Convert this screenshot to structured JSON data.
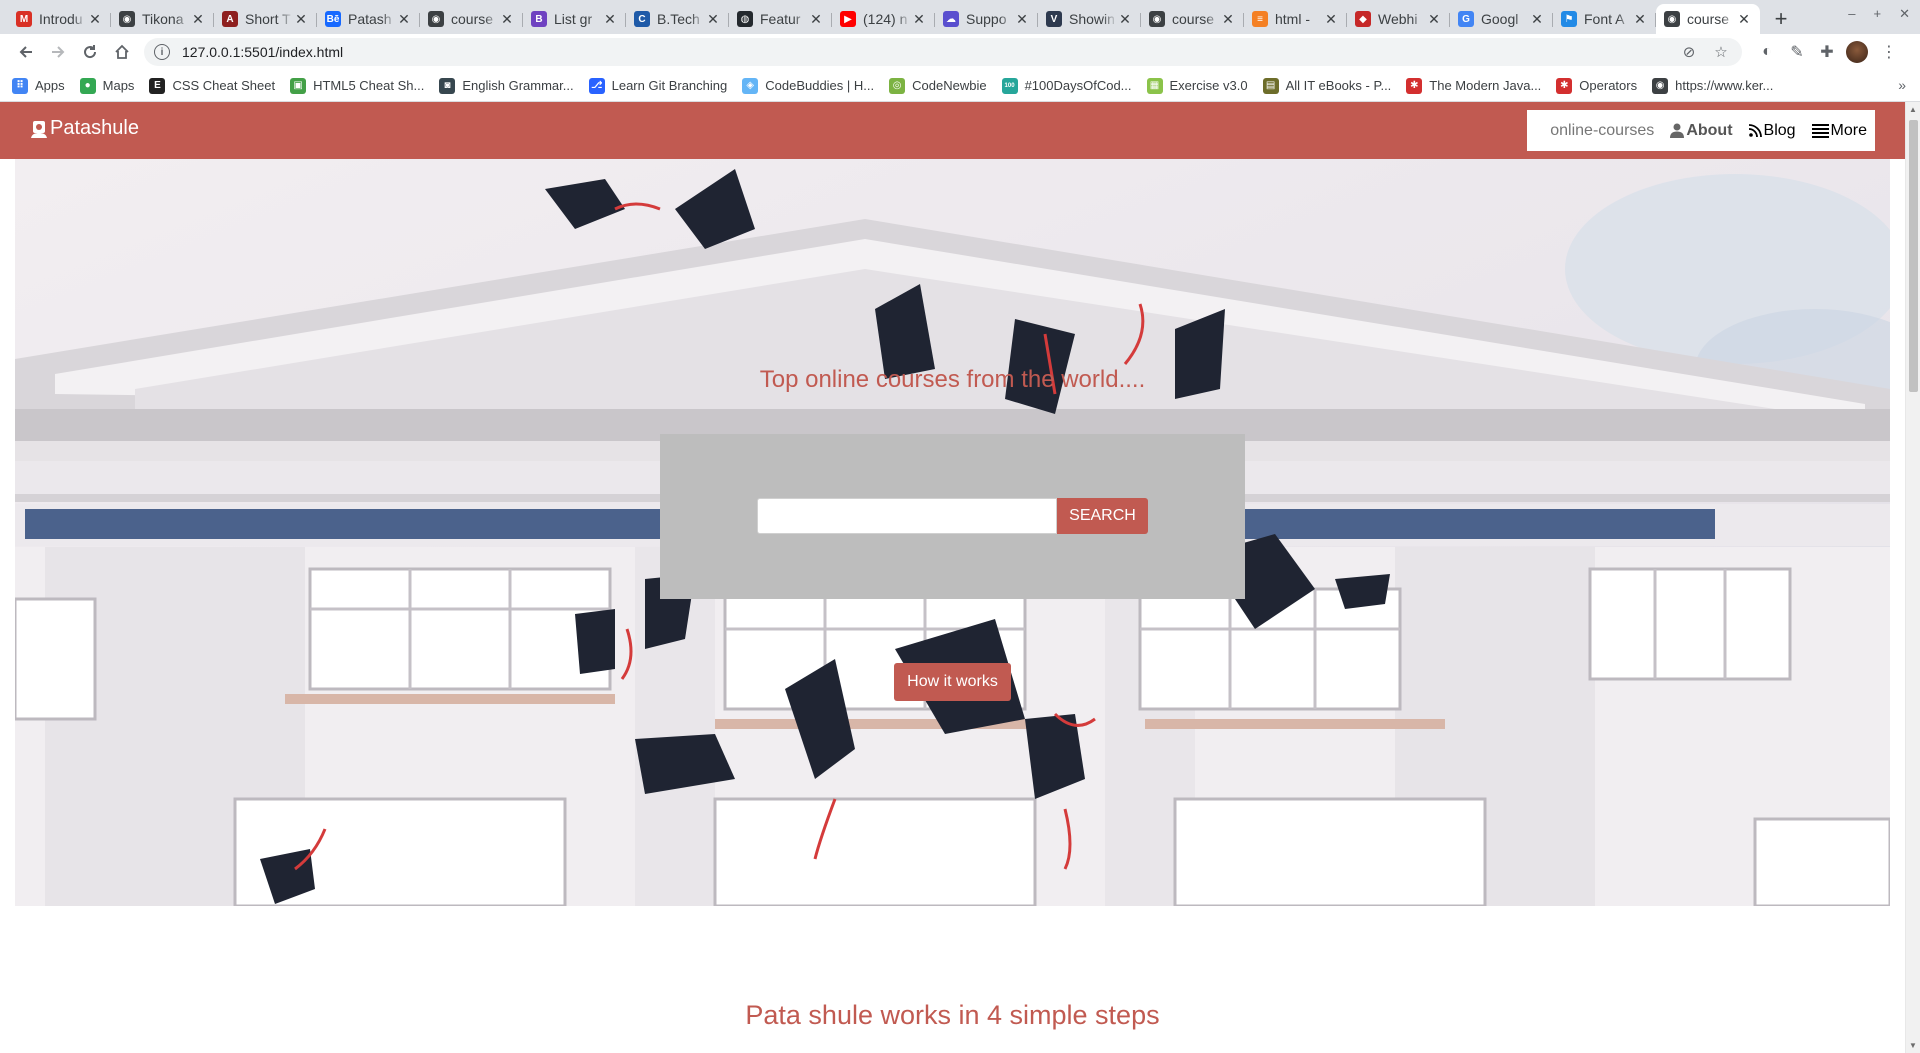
{
  "browser": {
    "tabs": [
      {
        "title": "Introdu",
        "icon": "gmail-icon",
        "color": "#d93025",
        "glyph": "M"
      },
      {
        "title": "Tikona",
        "icon": "globe-icon",
        "color": "#3c4043",
        "glyph": "◉"
      },
      {
        "title": "Short T",
        "icon": "site-icon",
        "color": "#8e1f1f",
        "glyph": "A"
      },
      {
        "title": "Patash",
        "icon": "behance-icon",
        "color": "#1769ff",
        "glyph": "Bē"
      },
      {
        "title": "course",
        "icon": "globe-icon",
        "color": "#3c4043",
        "glyph": "◉"
      },
      {
        "title": "List gr",
        "icon": "bootstrap-icon",
        "color": "#6f42c1",
        "glyph": "B"
      },
      {
        "title": "B.Tech",
        "icon": "site-c-icon",
        "color": "#1e5aa8",
        "glyph": "C"
      },
      {
        "title": "Featur",
        "icon": "github-icon",
        "color": "#24292e",
        "glyph": "◍"
      },
      {
        "title": "(124) n",
        "icon": "youtube-icon",
        "color": "#ff0000",
        "glyph": "▶"
      },
      {
        "title": "Suppo",
        "icon": "cloud-icon",
        "color": "#5a4fcf",
        "glyph": "☁"
      },
      {
        "title": "Showin",
        "icon": "vue-icon",
        "color": "#2e3a4f",
        "glyph": "V"
      },
      {
        "title": "course",
        "icon": "globe-icon",
        "color": "#3c4043",
        "glyph": "◉"
      },
      {
        "title": "html - ",
        "icon": "stackoverflow-icon",
        "color": "#f48024",
        "glyph": "≡"
      },
      {
        "title": "Webhi",
        "icon": "bird-icon",
        "color": "#c62828",
        "glyph": "◆"
      },
      {
        "title": "Googl",
        "icon": "google-icon",
        "color": "#4285f4",
        "glyph": "G"
      },
      {
        "title": "Font A",
        "icon": "flag-icon",
        "color": "#228ae6",
        "glyph": "⚑"
      }
    ],
    "active_tab": {
      "title": "course",
      "icon": "globe-icon",
      "color": "#3c4043",
      "glyph": "◉"
    },
    "url": "127.0.0.1:5501/index.html",
    "bookmarks": [
      {
        "label": "Apps",
        "icon": "apps-grid-icon",
        "color": "#4285f4",
        "glyph": "⠿"
      },
      {
        "label": "Maps",
        "icon": "maps-pin-icon",
        "color": "#34a853",
        "glyph": "●"
      },
      {
        "label": "CSS Cheat Sheet",
        "icon": "css-icon",
        "color": "#222222",
        "glyph": "E"
      },
      {
        "label": "HTML5 Cheat Sh...",
        "icon": "html5-icon",
        "color": "#43a047",
        "glyph": "▣"
      },
      {
        "label": "English Grammar...",
        "icon": "grammar-icon",
        "color": "#37474f",
        "glyph": "◙"
      },
      {
        "label": "Learn Git Branching",
        "icon": "git-icon",
        "color": "#2962ff",
        "glyph": "⎇"
      },
      {
        "label": "CodeBuddies | H...",
        "icon": "codebuddies-icon",
        "color": "#64b5f6",
        "glyph": "◈"
      },
      {
        "label": "CodeNewbie",
        "icon": "codenewbie-icon",
        "color": "#7cb342",
        "glyph": "◎"
      },
      {
        "label": "#100DaysOfCod...",
        "icon": "100days-icon",
        "color": "#26a69a",
        "glyph": "100"
      },
      {
        "label": "Exercise v3.0",
        "icon": "exercise-icon",
        "color": "#8bc34a",
        "glyph": "▦"
      },
      {
        "label": "All IT eBooks - P...",
        "icon": "ebooks-icon",
        "color": "#6d6d2a",
        "glyph": "▤"
      },
      {
        "label": "The Modern Java...",
        "icon": "modern-js-icon",
        "color": "#d32f2f",
        "glyph": "✱"
      },
      {
        "label": "Operators",
        "icon": "modern-js-icon",
        "color": "#d32f2f",
        "glyph": "✱"
      },
      {
        "label": "https://www.ker...",
        "icon": "globe-icon",
        "color": "#3c4043",
        "glyph": "◉"
      }
    ]
  },
  "site": {
    "brand": "Patashule",
    "menu": {
      "courses": "online-courses",
      "about": "About",
      "blog": "Blog",
      "more": "More"
    },
    "hero": {
      "tagline": "Top online courses from the world....",
      "search_placeholder": "",
      "search_button": "SEARCH",
      "how_button": "How it works"
    },
    "steps_title": "Pata shule works in 4 simple steps",
    "colors": {
      "brand": "#c15a51",
      "panel": "#bdbdbd"
    }
  }
}
